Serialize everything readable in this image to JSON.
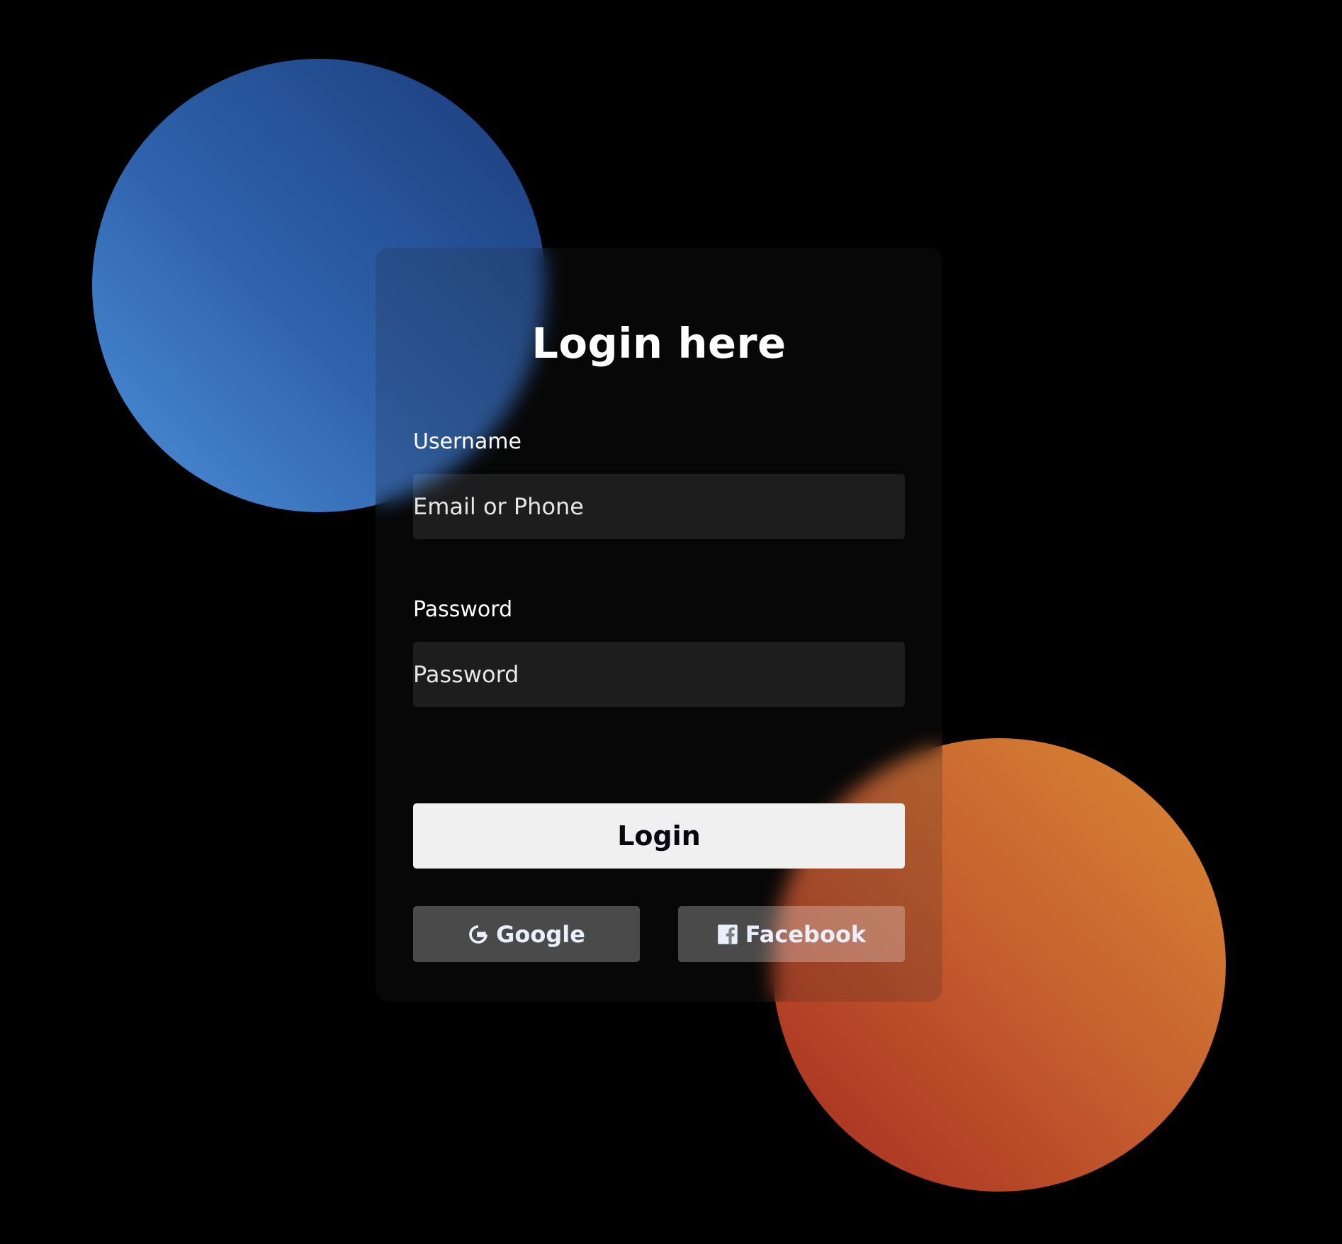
{
  "login_form": {
    "title": "Login here",
    "username": {
      "label": "Username",
      "placeholder": "Email or Phone"
    },
    "password": {
      "label": "Password",
      "placeholder": "Password"
    },
    "login_button": "Login",
    "social": {
      "google": {
        "label": "Google",
        "icon": "google-g-icon"
      },
      "facebook": {
        "label": "Facebook",
        "icon": "facebook-f-icon"
      }
    }
  },
  "colors": {
    "background": "#000000",
    "blue_shape_light": "#4e90da",
    "blue_shape_dark": "#1a3a7a",
    "orange_shape_light": "#db8a35",
    "orange_shape_dark": "#a42b1e",
    "login_button_bg": "#f0f0f0",
    "login_button_text": "#080710"
  }
}
